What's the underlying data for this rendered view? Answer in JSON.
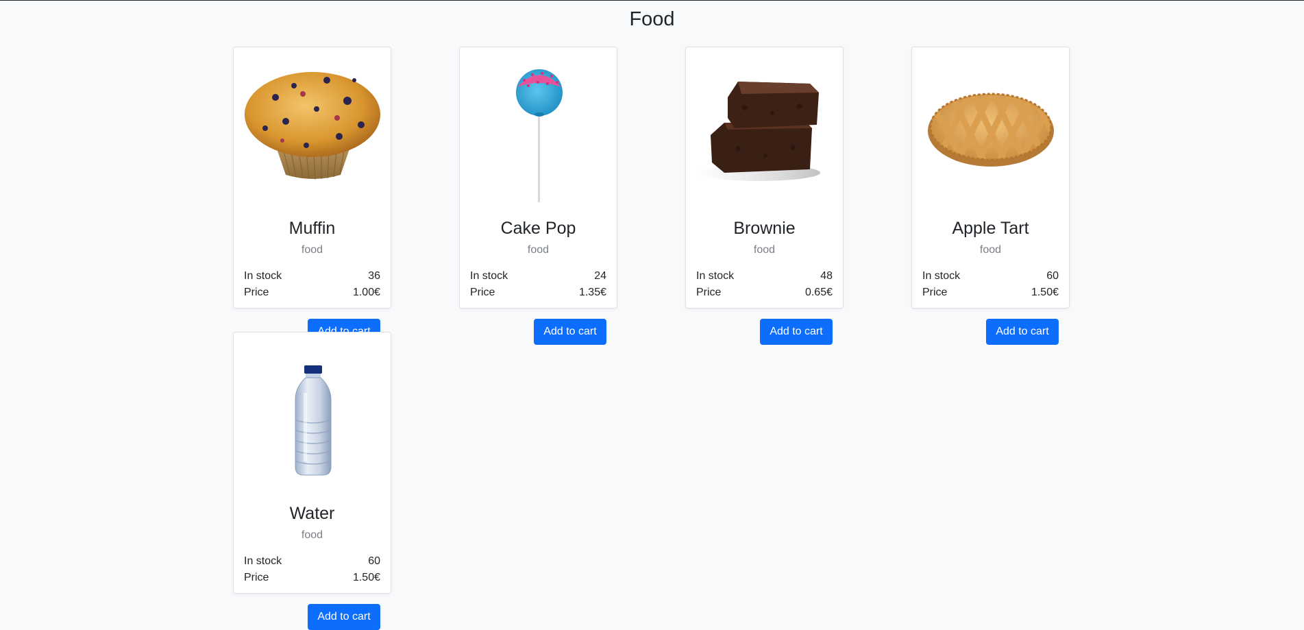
{
  "page": {
    "title": "Food"
  },
  "products": [
    {
      "name": "Muffin",
      "category": "food",
      "stock_label": "In stock",
      "stock": "36",
      "price_label": "Price",
      "price": "1.00€",
      "button": "Add to cart",
      "image": "muffin"
    },
    {
      "name": "Cake Pop",
      "category": "food",
      "stock_label": "In stock",
      "stock": "24",
      "price_label": "Price",
      "price": "1.35€",
      "button": "Add to cart",
      "image": "cake-pop"
    },
    {
      "name": "Brownie",
      "category": "food",
      "stock_label": "In stock",
      "stock": "48",
      "price_label": "Price",
      "price": "0.65€",
      "button": "Add to cart",
      "image": "brownie"
    },
    {
      "name": "Apple Tart",
      "category": "food",
      "stock_label": "In stock",
      "stock": "60",
      "price_label": "Price",
      "price": "1.50€",
      "button": "Add to cart",
      "image": "apple-tart"
    },
    {
      "name": "Water",
      "category": "food",
      "stock_label": "In stock",
      "stock": "60",
      "price_label": "Price",
      "price": "1.50€",
      "button": "Add to cart",
      "image": "water-bottle"
    }
  ],
  "colors": {
    "background": "#f8f9fa",
    "primary": "#0d6efd",
    "muted": "#7a7f85"
  }
}
